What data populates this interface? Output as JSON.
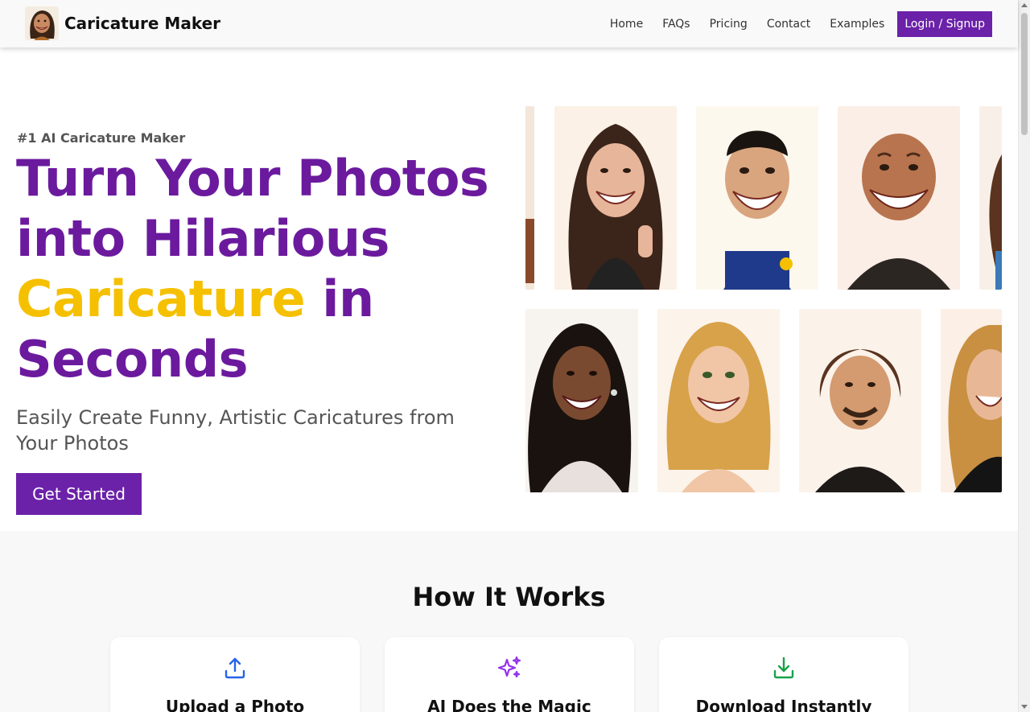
{
  "header": {
    "brand_name": "Caricature Maker",
    "logo_icon": "caricature-avatar-logo",
    "nav": [
      "Home",
      "FAQs",
      "Pricing",
      "Contact",
      "Examples"
    ],
    "login_label": "Login / Signup"
  },
  "hero": {
    "kicker": "#1 AI Caricature Maker",
    "title_line1": "Turn Your Photos",
    "title_line2": "into Hilarious",
    "title_accent": "Caricature",
    "title_after_accent": " in",
    "title_line4": "Seconds",
    "subtitle": "Easily Create Funny, Artistic Caricatures from Your Photos",
    "cta_label": "Get Started"
  },
  "gallery": {
    "images": [
      "caricature-woman-waving",
      "caricature-footballer",
      "caricature-bald-man",
      "caricature-woman-curly-hair",
      "caricature-woman-dark-hair",
      "caricature-blonde-woman",
      "caricature-man-goatee",
      "caricature-woman-blonde-black-dress"
    ]
  },
  "how_it_works": {
    "title": "How It Works",
    "steps": [
      {
        "title": "Upload a Photo",
        "icon": "upload-icon",
        "color": "#2563eb"
      },
      {
        "title": "AI Does the Magic",
        "icon": "sparkles-icon",
        "color": "#9333ea"
      },
      {
        "title": "Download Instantly",
        "icon": "download-icon",
        "color": "#16a34a"
      }
    ]
  },
  "colors": {
    "brand_purple": "#6b21a8",
    "title_purple": "#6b1a9e",
    "accent_yellow": "#f5c000"
  }
}
